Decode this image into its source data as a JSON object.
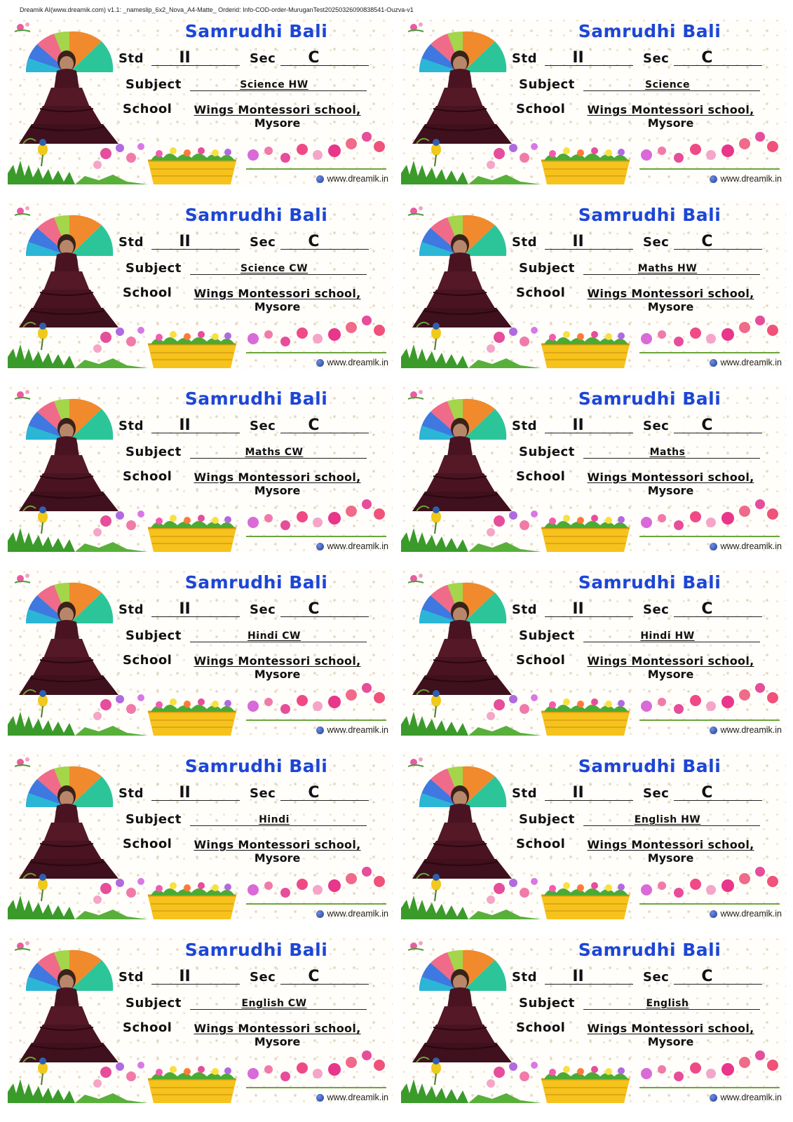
{
  "header": "Dreamik AI(www.dreamik.com) v1.1: _nameslip_6x2_Nova_A4-Matte_ Orderid: Info-COD-order-MuruganTest20250326090838541-Ouzva-v1",
  "fields": {
    "std_label": "Std",
    "sec_label": "Sec",
    "subject_label": "Subject",
    "school_label": "School"
  },
  "labels": [
    {
      "name": "Samrudhi Bali",
      "std": "II",
      "sec": "C",
      "subject": "Science HW",
      "school": "Wings Montessori school,",
      "city": "Mysore",
      "site": "www.dreamik.in"
    },
    {
      "name": "Samrudhi Bali",
      "std": "II",
      "sec": "C",
      "subject": "Science",
      "school": "Wings Montessori school,",
      "city": "Mysore",
      "site": "www.dreamik.in"
    },
    {
      "name": "Samrudhi Bali",
      "std": "II",
      "sec": "C",
      "subject": "Science CW",
      "school": "Wings Montessori school,",
      "city": "Mysore",
      "site": "www.dreamik.in"
    },
    {
      "name": "Samrudhi Bali",
      "std": "II",
      "sec": "C",
      "subject": "Maths HW",
      "school": "Wings Montessori school,",
      "city": "Mysore",
      "site": "www.dreamik.in"
    },
    {
      "name": "Samrudhi Bali",
      "std": "II",
      "sec": "C",
      "subject": "Maths CW",
      "school": "Wings Montessori school,",
      "city": "Mysore",
      "site": "www.dreamik.in"
    },
    {
      "name": "Samrudhi Bali",
      "std": "II",
      "sec": "C",
      "subject": "Maths",
      "school": "Wings Montessori school,",
      "city": "Mysore",
      "site": "www.dreamik.in"
    },
    {
      "name": "Samrudhi Bali",
      "std": "II",
      "sec": "C",
      "subject": "Hindi CW",
      "school": "Wings Montessori school,",
      "city": "Mysore",
      "site": "www.dreamik.in"
    },
    {
      "name": "Samrudhi Bali",
      "std": "II",
      "sec": "C",
      "subject": "Hindi HW",
      "school": "Wings Montessori school,",
      "city": "Mysore",
      "site": "www.dreamik.in"
    },
    {
      "name": "Samrudhi Bali",
      "std": "II",
      "sec": "C",
      "subject": "Hindi",
      "school": "Wings Montessori school,",
      "city": "Mysore",
      "site": "www.dreamik.in"
    },
    {
      "name": "Samrudhi Bali",
      "std": "II",
      "sec": "C",
      "subject": "English HW",
      "school": "Wings Montessori school,",
      "city": "Mysore",
      "site": "www.dreamik.in"
    },
    {
      "name": "Samrudhi Bali",
      "std": "II",
      "sec": "C",
      "subject": "English CW",
      "school": "Wings Montessori school,",
      "city": "Mysore",
      "site": "www.dreamik.in"
    },
    {
      "name": "Samrudhi Bali",
      "std": "II",
      "sec": "C",
      "subject": "English",
      "school": "Wings Montessori school,",
      "city": "Mysore",
      "site": "www.dreamik.in"
    }
  ],
  "colors": {
    "name_blue": "#1d46d6",
    "dress": "#4a1322",
    "pot": "#f6c21c"
  }
}
